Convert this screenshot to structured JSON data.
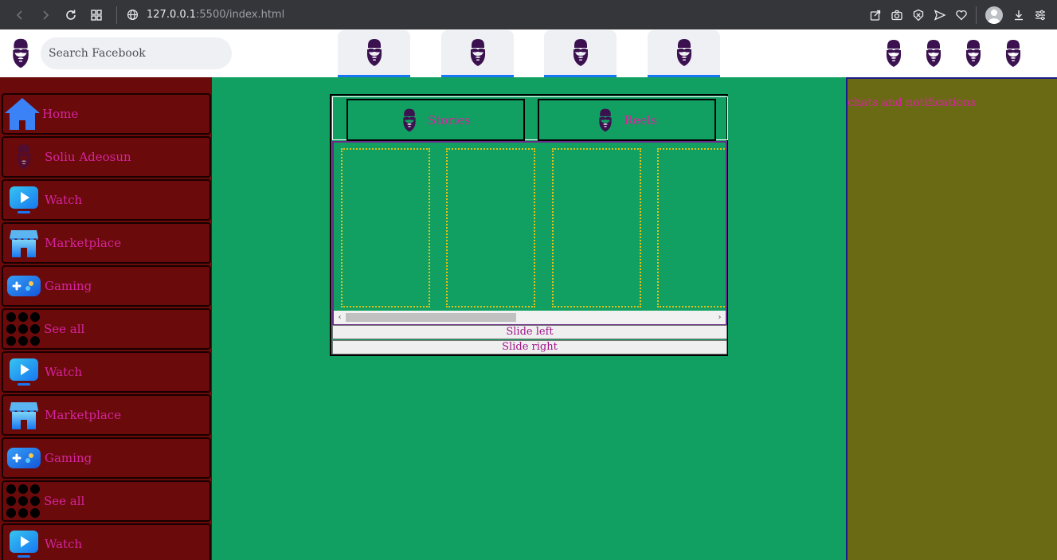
{
  "browser": {
    "url_host": "127.0.0.1",
    "url_path": ":5500/index.html"
  },
  "header": {
    "search_placeholder": "Search Facebook"
  },
  "sidebar": {
    "items": [
      {
        "label": "Home",
        "icon": "home-icon"
      },
      {
        "label": "Soliu Adeosun",
        "icon": "profile-avatar-icon"
      },
      {
        "label": "Watch",
        "icon": "watch-icon"
      },
      {
        "label": "Marketplace",
        "icon": "marketplace-icon"
      },
      {
        "label": "Gaming",
        "icon": "gaming-icon"
      },
      {
        "label": "See all",
        "icon": "grid-dots-icon"
      },
      {
        "label": "Watch",
        "icon": "watch-icon"
      },
      {
        "label": "Marketplace",
        "icon": "marketplace-icon"
      },
      {
        "label": "Gaming",
        "icon": "gaming-icon"
      },
      {
        "label": "See all",
        "icon": "grid-dots-icon"
      },
      {
        "label": "Watch",
        "icon": "watch-icon"
      }
    ]
  },
  "main": {
    "tabs": [
      {
        "label": "Stories"
      },
      {
        "label": "Reels"
      }
    ],
    "slide_left_label": "Slide left",
    "slide_right_label": "Slide right"
  },
  "rightbar": {
    "title": "chats and notifications"
  },
  "colors": {
    "page_bg": "#12a062",
    "sidebar_bg": "#6b0a0a",
    "rightbar_bg": "#6b6a14",
    "text_accent": "#d6249f",
    "nav_underline": "#1877f2",
    "card_border": "#e3c21a"
  }
}
